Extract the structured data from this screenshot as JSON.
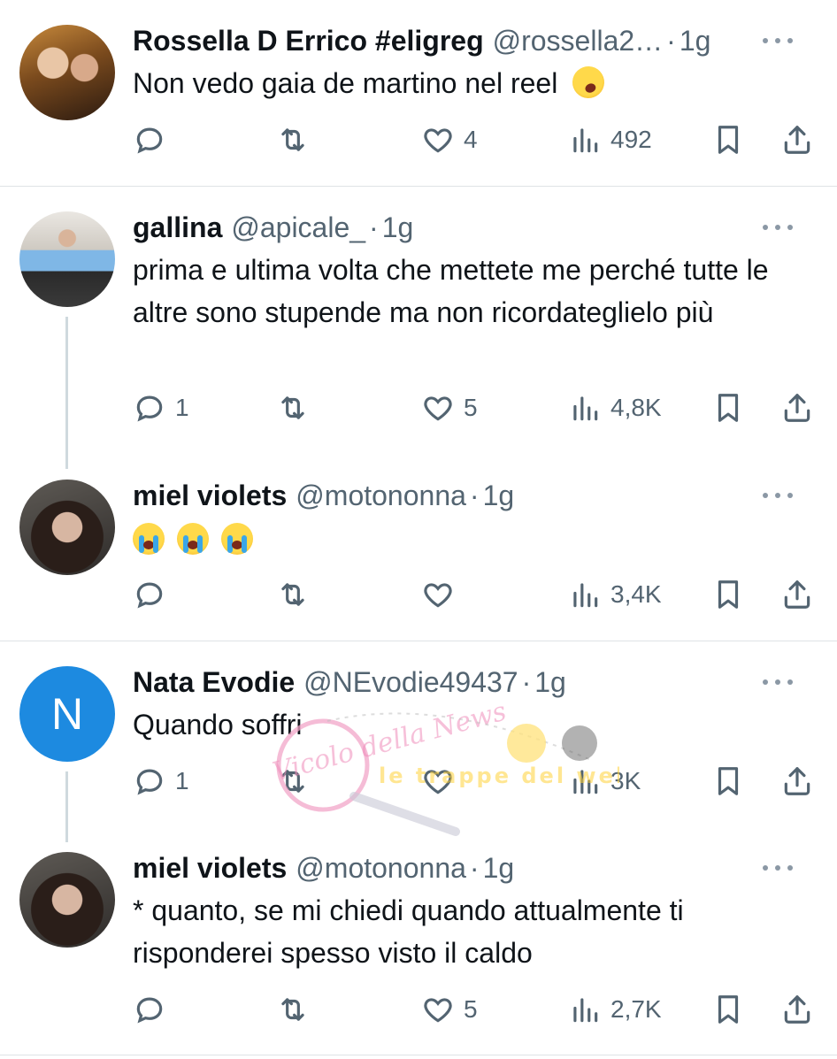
{
  "tweets": [
    {
      "name": "Rossella D Errico #eligreg",
      "handle": "@rossella2…",
      "time": "1g",
      "text": "Non vedo gaia de martino nel reel",
      "emoji": "rolling-on-floor-laughing",
      "replies": "",
      "reposts": "",
      "likes": "4",
      "views": "492"
    },
    {
      "name": "gallina",
      "handle": "@apicale_",
      "time": "1g",
      "text": "prima e ultima volta che mettete me perché tutte le altre sono stupende ma non ricordateglielo più",
      "replies": "1",
      "reposts": "",
      "likes": "5",
      "views": "4,8K"
    },
    {
      "name": "miel violets",
      "handle": "@motononna",
      "time": "1g",
      "text": "",
      "emoji": "loudly-crying-face x3",
      "replies": "",
      "reposts": "",
      "likes": "",
      "views": "3,4K"
    },
    {
      "name": "Nata Evodie",
      "handle": "@NEvodie49437",
      "time": "1g",
      "avatar_letter": "N",
      "text": "Quando soffri",
      "replies": "1",
      "reposts": "",
      "likes": "",
      "views": "3K"
    },
    {
      "name": "miel violets",
      "handle": "@motononna",
      "time": "1g",
      "text": "* quanto, se mi chiedi quando attualmente ti risponderei spesso visto il caldo",
      "replies": "",
      "reposts": "",
      "likes": "5",
      "views": "2,7K"
    }
  ],
  "separator": "·",
  "watermark": {
    "left_text": "Vicolo della News",
    "right_text": "le trappe del web"
  },
  "colors": {
    "text": "#0f1419",
    "secondary": "#536471",
    "avatar_letter_bg": "#1d8ae0",
    "divider": "#dfe3e6"
  }
}
